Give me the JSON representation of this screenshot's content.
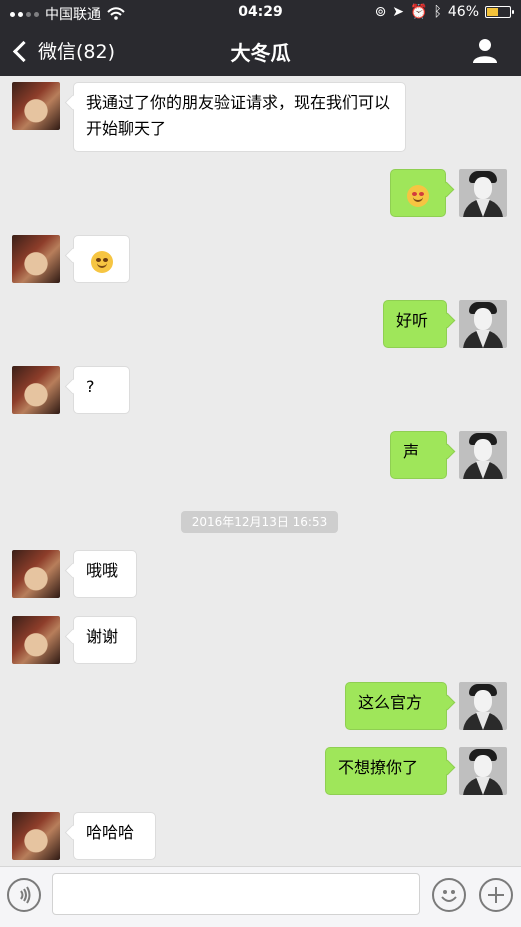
{
  "status_bar": {
    "carrier": "中国联通",
    "time": "04:29",
    "battery_percent": "46%"
  },
  "nav": {
    "back_label": "微信(82)",
    "title": "大冬瓜"
  },
  "messages": [
    {
      "side": "left",
      "text": "我通过了你的朋友验证请求，现在我们可以开始聊天了"
    },
    {
      "side": "right",
      "text": "",
      "emoji": "smile-heart-eyes-emoji"
    },
    {
      "side": "left",
      "text": "",
      "emoji": "grimace-emoji"
    },
    {
      "side": "right",
      "text": "好听"
    },
    {
      "side": "left",
      "text": "?"
    },
    {
      "side": "right",
      "text": "声"
    },
    {
      "side": "left",
      "text": "哦哦"
    },
    {
      "side": "left",
      "text": "谢谢"
    },
    {
      "side": "right",
      "text": "这么官方"
    },
    {
      "side": "right",
      "text": "不想撩你了"
    },
    {
      "side": "left",
      "text": "哈哈哈"
    }
  ],
  "timestamp": "2016年12月13日 16:53",
  "colors": {
    "topbar": "#2a2a2f",
    "chat_background": "#ebebeb",
    "self_bubble": "#9fe65a",
    "other_bubble": "#ffffff"
  }
}
